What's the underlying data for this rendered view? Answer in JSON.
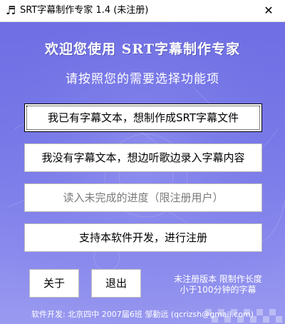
{
  "window": {
    "app_icon": "♬",
    "title": "SRT字幕制作专家 1.4 (未注册)",
    "close_glyph": "✕"
  },
  "main": {
    "welcome": "欢迎您使用 SRT字幕制作专家",
    "prompt": "请按照您的需要选择功能项",
    "buttons": {
      "have_text": "我已有字幕文本，想制作成SRT字幕文件",
      "no_text": "我没有字幕文本，想边听歌边录入字幕内容",
      "load_progress": "读入未完成的进度（限注册用户）",
      "register": "支持本软件开发，进行注册",
      "about": "关于",
      "exit": "退出"
    },
    "notice_line1": "未注册版本 限制作长度",
    "notice_line2": "小于100分钟的字幕",
    "footer": "软件开发: 北京四中 2007届6班 邹勤远 (qcrizsh@gmail.com)"
  },
  "colors": {
    "background_top": "#6f6fe4",
    "background_bottom": "#9a9af0",
    "text_light": "#ffffff",
    "disabled_text": "#7a7a7a"
  }
}
